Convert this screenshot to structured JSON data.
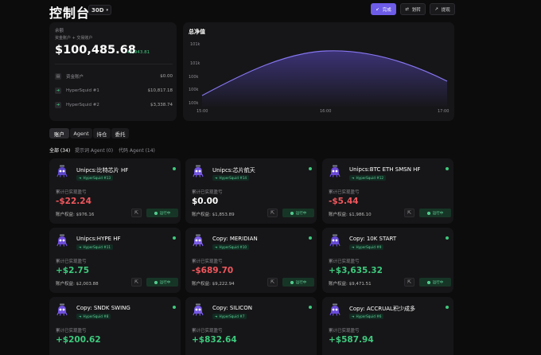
{
  "header": {
    "title": "控制台",
    "period": "30D",
    "buttons": {
      "complete": "完成",
      "transfer": "划转",
      "withdraw": "提现"
    }
  },
  "balance": {
    "label": "余额",
    "sublabel": "资金账户 + 交易账户",
    "amount": "$100,485.68",
    "change": "+1,943.81",
    "rows": [
      {
        "icon": "wallet-icon",
        "name": "资金账户",
        "value": "$0.00"
      },
      {
        "icon": "arrow-icon",
        "name": "HyperSquid #1",
        "value": "$10,817.18"
      },
      {
        "icon": "arrow-icon",
        "name": "HyperSquid #2",
        "value": "$3,338.74"
      }
    ]
  },
  "networth": {
    "title": "总净值",
    "y_ticks": [
      "101k",
      "101k",
      "100k",
      "100k",
      "100k"
    ],
    "x_ticks": [
      "15:00",
      "16:00",
      "17:00"
    ]
  },
  "tabs": [
    "账户",
    "Agent",
    "持仓",
    "委托"
  ],
  "filters": [
    "全部 (34)",
    "提示词 Agent (0)",
    "代码 Agent (14)"
  ],
  "strings": {
    "pnl_label": "累计已实现盈亏",
    "equity_prefix": "账户权益: ",
    "running": "运行中"
  },
  "agents": [
    {
      "name": "Unipcs:比特芯片 HF",
      "badge": "HyperSquid #13",
      "pnl": "-$22.24",
      "sign": "neg",
      "equity": "$976.16",
      "avatar": "#5a45c8"
    },
    {
      "name": "Unipcs:芯片航天",
      "badge": "HyperSquid #14",
      "pnl": "$0.00",
      "sign": "zero",
      "equity": "$1,853.89",
      "avatar": "#7355e0"
    },
    {
      "name": "Unipcs:BTC ETH SMSN HF",
      "badge": "HyperSquid #12",
      "pnl": "-$5.44",
      "sign": "neg",
      "equity": "$1,986.10",
      "avatar": "#6a48d6"
    },
    {
      "name": "Unipcs:HYPE HF",
      "badge": "HyperSquid #11",
      "pnl": "+$2.75",
      "sign": "pos",
      "equity": "$2,003.88",
      "avatar": "#6c4ad8"
    },
    {
      "name": "Copy: MERIDIAN",
      "badge": "HyperSquid #10",
      "pnl": "-$689.70",
      "sign": "neg",
      "equity": "$9,222.94",
      "avatar": "#7a5ce6"
    },
    {
      "name": "Copy: 10K START",
      "badge": "HyperSquid #9",
      "pnl": "+$3,635.32",
      "sign": "pos",
      "equity": "$9,471.51",
      "avatar": "#6549d4"
    },
    {
      "name": "Copy: SNDK SWING",
      "badge": "HyperSquid #8",
      "pnl": "+$200.62",
      "sign": "pos",
      "equity": "",
      "avatar": "#6f50de"
    },
    {
      "name": "Copy: SILICON",
      "badge": "HyperSquid #7",
      "pnl": "+$832.64",
      "sign": "pos",
      "equity": "",
      "avatar": "#7558e2"
    },
    {
      "name": "Copy: ACCRUAL积少成多",
      "badge": "HyperSquid #6",
      "pnl": "+$587.94",
      "sign": "pos",
      "equity": "",
      "avatar": "#6a4bd9"
    }
  ]
}
